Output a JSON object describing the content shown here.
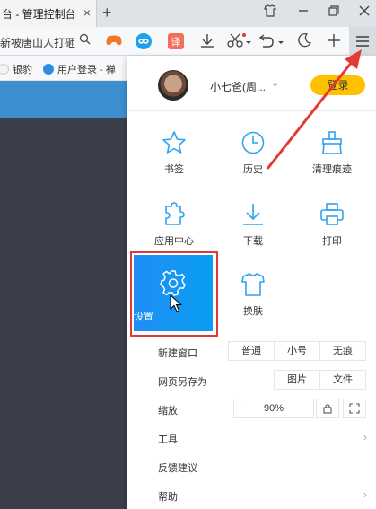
{
  "browser": {
    "tab_title": "台 - 管理控制台",
    "tab_close": "×",
    "new_tab": "+",
    "address_text": "新被唐山人打砸",
    "bookmarks": [
      {
        "label": "银豹"
      },
      {
        "label": "用户登录 - 禅"
      }
    ]
  },
  "menu": {
    "user": {
      "name": "小七爸(周...",
      "login_label": "登录"
    },
    "grid": [
      {
        "label": "书签",
        "icon": "star-icon"
      },
      {
        "label": "历史",
        "icon": "clock-icon"
      },
      {
        "label": "清理痕迹",
        "icon": "broom-icon"
      },
      {
        "label": "应用中心",
        "icon": "puzzle-icon"
      },
      {
        "label": "下载",
        "icon": "download-icon"
      },
      {
        "label": "打印",
        "icon": "printer-icon"
      },
      {
        "label": "设置",
        "icon": "gear-icon"
      },
      {
        "label": "换肤",
        "icon": "shirt-icon"
      }
    ],
    "new_window": {
      "label": "新建窗口",
      "options": [
        "普通",
        "小号",
        "无痕"
      ]
    },
    "save_as": {
      "label": "网页另存为",
      "options": [
        "图片",
        "文件"
      ]
    },
    "zoom": {
      "label": "缩放",
      "minus": "−",
      "value": "90%",
      "plus": "+"
    },
    "tools": {
      "label": "工具"
    },
    "feedback": {
      "label": "反馈建议"
    },
    "help": {
      "label": "帮助"
    }
  },
  "colors": {
    "accent": "#1f8ef5",
    "login_button": "#ffc000",
    "highlight": "#e03838"
  }
}
